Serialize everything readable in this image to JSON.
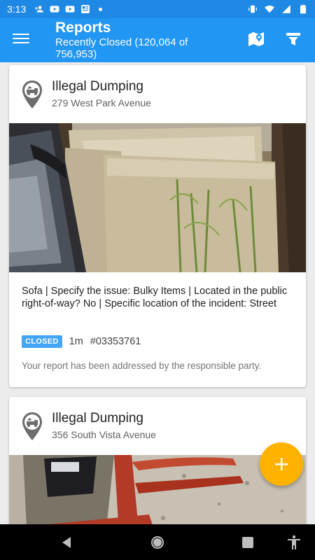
{
  "status_bar": {
    "time": "3:13",
    "left_icons": [
      "person-add-icon",
      "youtube-icon",
      "youtube-icon",
      "news-icon"
    ],
    "right_icons": [
      "vibrate-icon",
      "wifi-icon",
      "signal-icon",
      "battery-icon"
    ]
  },
  "app_bar": {
    "title": "Reports",
    "subtitle": "Recently Closed (120,064 of 756,953)",
    "background": "#2196f3"
  },
  "reports": [
    {
      "title": "Illegal Dumping",
      "address": "279 West Park Avenue",
      "description": "Sofa | Specify the issue: Bulky Items | Located in the public right-of-way? No | Specific location of the incident: Street",
      "status": "CLOSED",
      "age": "1m",
      "id": "#03353761",
      "message": "Your report has been addressed by the responsible party."
    },
    {
      "title": "Illegal Dumping",
      "address": "356 South Vista Avenue"
    }
  ],
  "fab": {
    "icon": "plus-icon",
    "color": "#ffb300"
  },
  "nav_bar": {
    "icons": [
      "back-icon",
      "home-icon",
      "recents-icon",
      "accessibility-icon"
    ]
  }
}
